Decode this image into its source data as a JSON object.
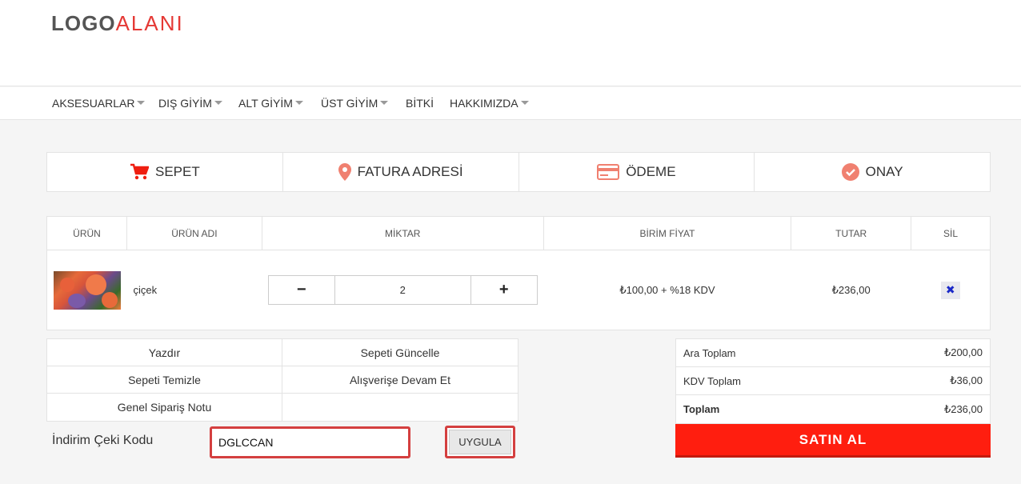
{
  "logo": {
    "part1": "LOGO",
    "part2": "ALANI"
  },
  "nav": {
    "items": [
      {
        "label": "AKSESUARLAR",
        "dropdown": true
      },
      {
        "label": "DIŞ GİYİM",
        "dropdown": true
      },
      {
        "label": "ALT GİYİM",
        "dropdown": true
      },
      {
        "label": "ÜST GİYİM",
        "dropdown": true
      },
      {
        "label": "BİTKİ",
        "dropdown": false
      },
      {
        "label": "HAKKIMIZDA",
        "dropdown": true
      }
    ]
  },
  "steps": [
    {
      "label": "SEPET",
      "icon": "cart-icon"
    },
    {
      "label": "FATURA ADRESİ",
      "icon": "map-pin-icon"
    },
    {
      "label": "ÖDEME",
      "icon": "credit-card-icon"
    },
    {
      "label": "ONAY",
      "icon": "check-circle-icon"
    }
  ],
  "cart": {
    "headers": [
      "ÜRÜN",
      "ÜRÜN ADI",
      "MİKTAR",
      "BİRİM FİYAT",
      "TUTAR",
      "SİL"
    ],
    "rows": [
      {
        "name": "çiçek",
        "quantity": "2",
        "unit_price": "₺100,00 + %18 KDV",
        "total": "₺236,00",
        "minus": "−",
        "plus": "+",
        "delete": "✖"
      }
    ]
  },
  "actions": [
    "Yazdır",
    "Sepeti Güncelle",
    "Sepeti Temizle",
    "Alışverişe Devam Et",
    "Genel Sipariş Notu",
    ""
  ],
  "coupon": {
    "label": "İndirim Çeki Kodu",
    "value": "DGLCCAN",
    "apply_label": "UYGULA"
  },
  "totals": {
    "subtotal_label": "Ara Toplam",
    "subtotal": "₺200,00",
    "tax_label": "KDV Toplam",
    "tax": "₺36,00",
    "total_label": "Toplam",
    "total": "₺236,00"
  },
  "buy_label": "SATIN AL",
  "colors": {
    "accent": "#ff1e0f",
    "icon": "#f08070",
    "highlight": "#d43f3f"
  }
}
